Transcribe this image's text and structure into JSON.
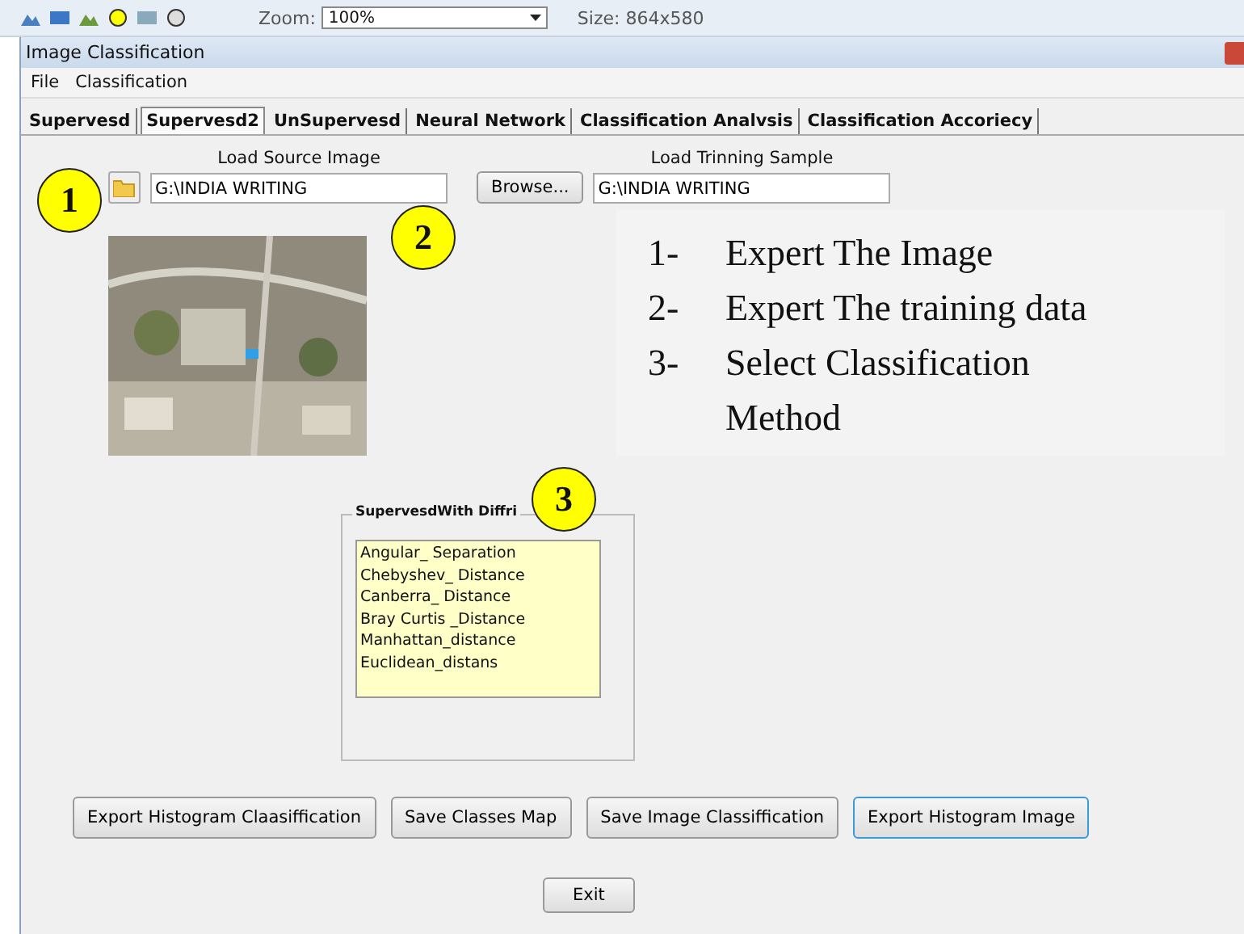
{
  "toolbar": {
    "zoom_label": "Zoom:",
    "zoom_value": "100%",
    "size": "Size: 864x580"
  },
  "window": {
    "title": "Image Classification"
  },
  "menu": [
    "File",
    "Classification"
  ],
  "tabs": [
    {
      "label": "Supervesd",
      "selected": false
    },
    {
      "label": "Supervesd2",
      "selected": true
    },
    {
      "label": "UnSupervesd",
      "selected": false
    },
    {
      "label": "Neural Network",
      "selected": false
    },
    {
      "label": "Classification Analvsis",
      "selected": false
    },
    {
      "label": "Classification Accoriecy",
      "selected": false
    }
  ],
  "source": {
    "label": "Load Source Image",
    "value": "G:\\INDIA WRITING"
  },
  "training": {
    "label": "Load Trinning Sample",
    "button": "Browse...",
    "value": "G:\\INDIA WRITING"
  },
  "steps": [
    {
      "number": "1-",
      "text": "Expert The Image"
    },
    {
      "number": "2-",
      "text": "Expert The training data"
    },
    {
      "number": "3-",
      "text": "Select Classification Method"
    }
  ],
  "method_group": {
    "title": "SupervesdWith Diffri",
    "items": [
      "Angular_ Separation",
      "Chebyshev_ Distance",
      "Canberra_ Distance",
      "Bray Curtis _Distance",
      "Manhattan_distance",
      "Euclidean_distans"
    ]
  },
  "buttons": [
    {
      "label": "Export  Histogram Claasiffication",
      "selected": false
    },
    {
      "label": "Save Classes Map",
      "selected": false
    },
    {
      "label": "Save Image Classiffication",
      "selected": false
    },
    {
      "label": "Export  Histogram Image",
      "selected": true
    }
  ],
  "exit": "Exit",
  "callouts": [
    "1",
    "2",
    "3"
  ]
}
